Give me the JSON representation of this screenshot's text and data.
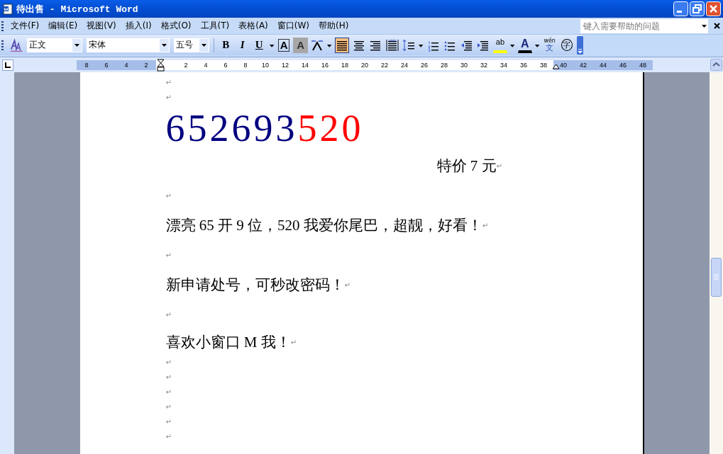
{
  "window": {
    "title": "待出售 - Microsoft Word"
  },
  "menu": [
    "文件(F)",
    "编辑(E)",
    "视图(V)",
    "插入(I)",
    "格式(O)",
    "工具(T)",
    "表格(A)",
    "窗口(W)",
    "帮助(H)"
  ],
  "help_box": {
    "placeholder": "键入需要帮助的问题"
  },
  "toolbar": {
    "style": "正文",
    "font": "宋体",
    "size": "五号",
    "buttons": [
      {
        "kind": "text",
        "label": "B",
        "selected": false
      },
      {
        "kind": "text",
        "label": "I",
        "selected": false
      },
      {
        "kind": "text",
        "label": "U",
        "selected": false
      },
      {
        "kind": "dropdown"
      },
      {
        "kind": "boxed",
        "label": "A",
        "selected": false
      },
      {
        "kind": "shaded",
        "label": "A",
        "selected": false
      },
      {
        "kind": "scale",
        "selected": false
      },
      {
        "kind": "dropdown"
      },
      {
        "kind": "align-left",
        "selected": true
      },
      {
        "kind": "align-center",
        "selected": false
      },
      {
        "kind": "align-right",
        "selected": false
      },
      {
        "kind": "justify",
        "selected": false
      },
      {
        "kind": "line-spacing",
        "selected": false
      },
      {
        "kind": "dropdown"
      },
      {
        "kind": "numbered-list",
        "selected": false
      },
      {
        "kind": "bullet-list",
        "selected": false
      },
      {
        "kind": "outdent",
        "selected": false
      },
      {
        "kind": "indent",
        "selected": false
      },
      {
        "kind": "highlight",
        "label": "ab",
        "selected": false
      },
      {
        "kind": "dropdown"
      },
      {
        "kind": "font-color",
        "label": "A",
        "selected": false
      },
      {
        "kind": "dropdown"
      },
      {
        "kind": "phonetic",
        "label": "wén",
        "label2": "文",
        "selected": false
      },
      {
        "kind": "enclose",
        "label": "字",
        "selected": false
      }
    ]
  },
  "ruler": {
    "labels": [
      {
        "text": "8",
        "margin": true
      },
      {
        "text": "6",
        "margin": true
      },
      {
        "text": "4",
        "margin": true
      },
      {
        "text": "2",
        "margin": true
      },
      {
        "margin": false
      },
      {
        "text": "2",
        "margin": false
      },
      {
        "text": "4",
        "margin": false
      },
      {
        "text": "6",
        "margin": false
      },
      {
        "text": "8",
        "margin": false
      },
      {
        "text": "10",
        "margin": false
      },
      {
        "text": "12",
        "margin": false
      },
      {
        "text": "14",
        "margin": false
      },
      {
        "text": "16",
        "margin": false
      },
      {
        "text": "18",
        "margin": false
      },
      {
        "text": "20",
        "margin": false
      },
      {
        "text": "22",
        "margin": false
      },
      {
        "text": "24",
        "margin": false
      },
      {
        "text": "26",
        "margin": false
      },
      {
        "text": "28",
        "margin": false
      },
      {
        "text": "30",
        "margin": false
      },
      {
        "text": "32",
        "margin": false
      },
      {
        "text": "34",
        "margin": false
      },
      {
        "text": "36",
        "margin": false
      },
      {
        "text": "38",
        "margin": false
      },
      {
        "text": "40",
        "margin": true
      },
      {
        "text": "42",
        "margin": true
      },
      {
        "text": "44",
        "margin": true
      },
      {
        "text": "46",
        "margin": true
      },
      {
        "text": "48",
        "margin": true
      }
    ]
  },
  "document": {
    "paragraphs": [
      {
        "kind": "blank",
        "mark": "↵"
      },
      {
        "kind": "blank",
        "mark": "↵"
      },
      {
        "kind": "number",
        "runs": [
          {
            "text": "652693",
            "color": "#000080"
          },
          {
            "text": "520",
            "color": "#ff0000"
          }
        ]
      },
      {
        "kind": "price",
        "text": "特价 7 元",
        "mark": "↵"
      },
      {
        "kind": "blank-large",
        "mark": "↵"
      },
      {
        "kind": "text",
        "text": "漂亮 65 开 9 位，520 我爱你尾巴，超靓，好看！",
        "mark": "↵"
      },
      {
        "kind": "blank-large",
        "mark": "↵"
      },
      {
        "kind": "text",
        "text": "新申请处号，可秒改密码！",
        "mark": "↵"
      },
      {
        "kind": "blank-large",
        "mark": "↵"
      },
      {
        "kind": "text",
        "text": "喜欢小窗口 M 我！",
        "mark": "↵"
      },
      {
        "kind": "blank",
        "mark": "↵"
      },
      {
        "kind": "blank",
        "mark": "↵"
      },
      {
        "kind": "blank",
        "mark": "↵"
      },
      {
        "kind": "blank",
        "mark": "↵"
      },
      {
        "kind": "blank",
        "mark": "↵"
      },
      {
        "kind": "blank",
        "mark": "↵"
      }
    ]
  }
}
